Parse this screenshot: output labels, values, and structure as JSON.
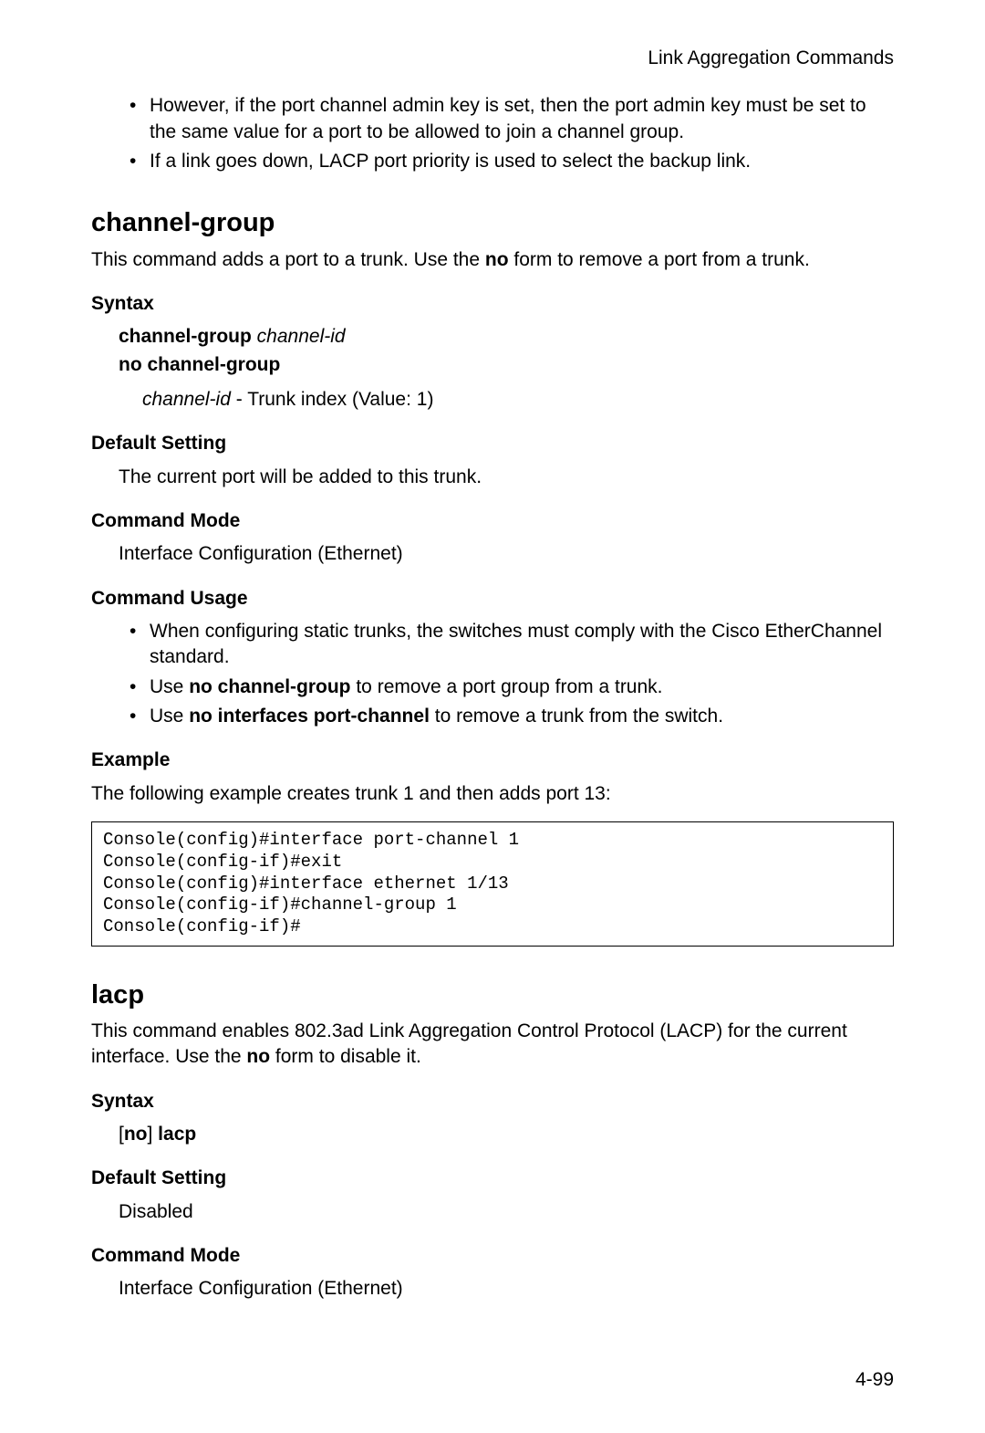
{
  "header": {
    "title": "Link Aggregation Commands"
  },
  "intro_bullets": [
    "However, if the port channel admin key is set, then the port admin key must be set to the same value for a port to be allowed to join a channel group.",
    "If a link goes down, LACP port priority is used to select the backup link."
  ],
  "section1": {
    "heading": "channel-group",
    "desc_pre": "This command adds a port to a trunk. Use the ",
    "desc_bold": "no",
    "desc_post": " form to remove a port from a trunk.",
    "syntax_label": "Syntax",
    "syntax_cmd_bold": "channel-group",
    "syntax_cmd_italic": " channel-id",
    "syntax_no": "no channel-group",
    "param_italic": "channel-id",
    "param_rest": " - Trunk index (Value: 1)",
    "default_label": "Default Setting",
    "default_text": "The current port will be added to this trunk.",
    "mode_label": "Command Mode",
    "mode_text": "Interface Configuration (Ethernet)",
    "usage_label": "Command Usage",
    "usage_items": {
      "i0": "When configuring static trunks, the switches must comply with the Cisco EtherChannel standard.",
      "i1_pre": "Use ",
      "i1_bold": "no channel-group",
      "i1_post": " to remove a port group from a trunk.",
      "i2_pre": "Use ",
      "i2_bold": "no interfaces port-channel",
      "i2_post": " to remove a trunk from the switch."
    },
    "example_label": "Example",
    "example_text": "The following example creates trunk 1 and then adds port 13:",
    "code": "Console(config)#interface port-channel 1\nConsole(config-if)#exit\nConsole(config)#interface ethernet 1/13\nConsole(config-if)#channel-group 1\nConsole(config-if)#"
  },
  "section2": {
    "heading": "lacp",
    "desc_pre": "This command enables 802.3ad Link Aggregation Control Protocol (LACP) for the current interface. Use the ",
    "desc_bold": "no",
    "desc_post": " form to disable it.",
    "syntax_label": "Syntax",
    "syntax_bracket_open": "[",
    "syntax_no": "no",
    "syntax_bracket_close": "]",
    "syntax_cmd": " lacp",
    "default_label": "Default Setting",
    "default_text": "Disabled",
    "mode_label": "Command Mode",
    "mode_text": "Interface Configuration (Ethernet)"
  },
  "footer": {
    "page": "4-99"
  }
}
